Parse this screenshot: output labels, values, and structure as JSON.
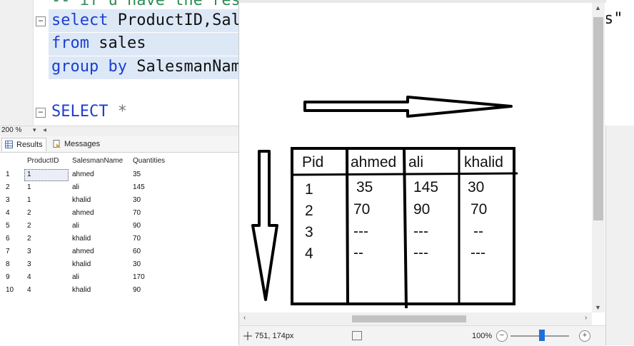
{
  "editor": {
    "comment_line": "-- if u have the result",
    "line1_kw": "select",
    "line1_rest": " ProductID,Sal",
    "line1_tail": "s\"",
    "line2_kw": "from",
    "line2_rest": " sales",
    "line3_kw": "group by",
    "line3_rest": " SalesmanNam",
    "line4_kw": "SELECT",
    "line4_rest": " *",
    "fold_symbol": "−"
  },
  "zoom_bar": {
    "value": "200 %",
    "dropdown": "▾",
    "arrow": "◂"
  },
  "results_tabs": {
    "results": "Results",
    "messages": "Messages"
  },
  "results_grid": {
    "columns": [
      "ProductID",
      "SalesmanName",
      "Quantities"
    ],
    "rows": [
      {
        "n": "1",
        "pid": "1",
        "name": "ahmed",
        "qty": "35"
      },
      {
        "n": "2",
        "pid": "1",
        "name": "ali",
        "qty": "145"
      },
      {
        "n": "3",
        "pid": "1",
        "name": "khalid",
        "qty": "30"
      },
      {
        "n": "4",
        "pid": "2",
        "name": "ahmed",
        "qty": "70"
      },
      {
        "n": "5",
        "pid": "2",
        "name": "ali",
        "qty": "90"
      },
      {
        "n": "6",
        "pid": "2",
        "name": "khalid",
        "qty": "70"
      },
      {
        "n": "7",
        "pid": "3",
        "name": "ahmed",
        "qty": "60"
      },
      {
        "n": "8",
        "pid": "3",
        "name": "khalid",
        "qty": "30"
      },
      {
        "n": "9",
        "pid": "4",
        "name": "ali",
        "qty": "170"
      },
      {
        "n": "10",
        "pid": "4",
        "name": "khalid",
        "qty": "90"
      }
    ]
  },
  "drawing": {
    "headers": [
      "Pid",
      "ahmed",
      "ali",
      "khalid"
    ],
    "pid_values": [
      "1",
      "2",
      "3",
      "4"
    ],
    "ahmed_values": [
      "35",
      "70",
      "---",
      "--"
    ],
    "ali_values": [
      "145",
      "90",
      "---",
      "---"
    ],
    "khalid_values": [
      "30",
      "70",
      "--",
      "---"
    ]
  },
  "paint_status": {
    "cursor_pos": "751, 174px",
    "zoom": "100%",
    "zoom_minus": "−",
    "zoom_plus": "+"
  },
  "scroll_arrows": {
    "up": "▲",
    "down": "▼",
    "left": "‹",
    "right": "›"
  }
}
